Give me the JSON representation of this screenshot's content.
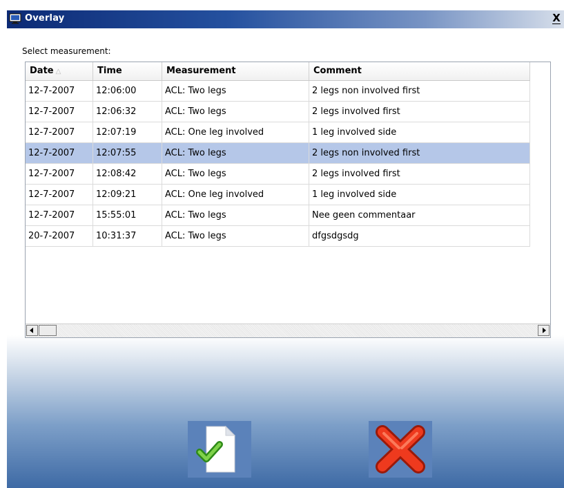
{
  "window": {
    "title": "Overlay",
    "close_glyph": "X"
  },
  "select_label": "Select measurement:",
  "table": {
    "columns": [
      {
        "label": "Date",
        "sort_indicator": "△"
      },
      {
        "label": "Time"
      },
      {
        "label": "Measurement"
      },
      {
        "label": "Comment"
      }
    ],
    "selected_row": 3,
    "rows": [
      {
        "date": "12-7-2007",
        "time": "12:06:00",
        "measurement": "ACL: Two legs",
        "comment": "2 legs non involved first"
      },
      {
        "date": "12-7-2007",
        "time": "12:06:32",
        "measurement": "ACL: Two legs",
        "comment": "2 legs involved first"
      },
      {
        "date": "12-7-2007",
        "time": "12:07:19",
        "measurement": "ACL: One leg involved",
        "comment": "1 leg involved side"
      },
      {
        "date": "12-7-2007",
        "time": "12:07:55",
        "measurement": "ACL: Two legs",
        "comment": "2 legs non involved first"
      },
      {
        "date": "12-7-2007",
        "time": "12:08:42",
        "measurement": "ACL: Two legs",
        "comment": "2 legs involved first"
      },
      {
        "date": "12-7-2007",
        "time": "12:09:21",
        "measurement": "ACL: One leg involved",
        "comment": "1 leg involved side"
      },
      {
        "date": "12-7-2007",
        "time": "15:55:01",
        "measurement": "ACL: Two legs",
        "comment": "Nee geen commentaar"
      },
      {
        "date": "20-7-2007",
        "time": "10:31:37",
        "measurement": "ACL: Two legs",
        "comment": "dfgsdgsdg"
      }
    ]
  },
  "buttons": {
    "ok_icon": "document-check-icon",
    "cancel_icon": "red-x-icon"
  },
  "colors": {
    "selection": "#b5c7e8",
    "button_bg": "#5b82ba",
    "check_green": "#4caf2a",
    "cancel_red": "#e8321c"
  }
}
